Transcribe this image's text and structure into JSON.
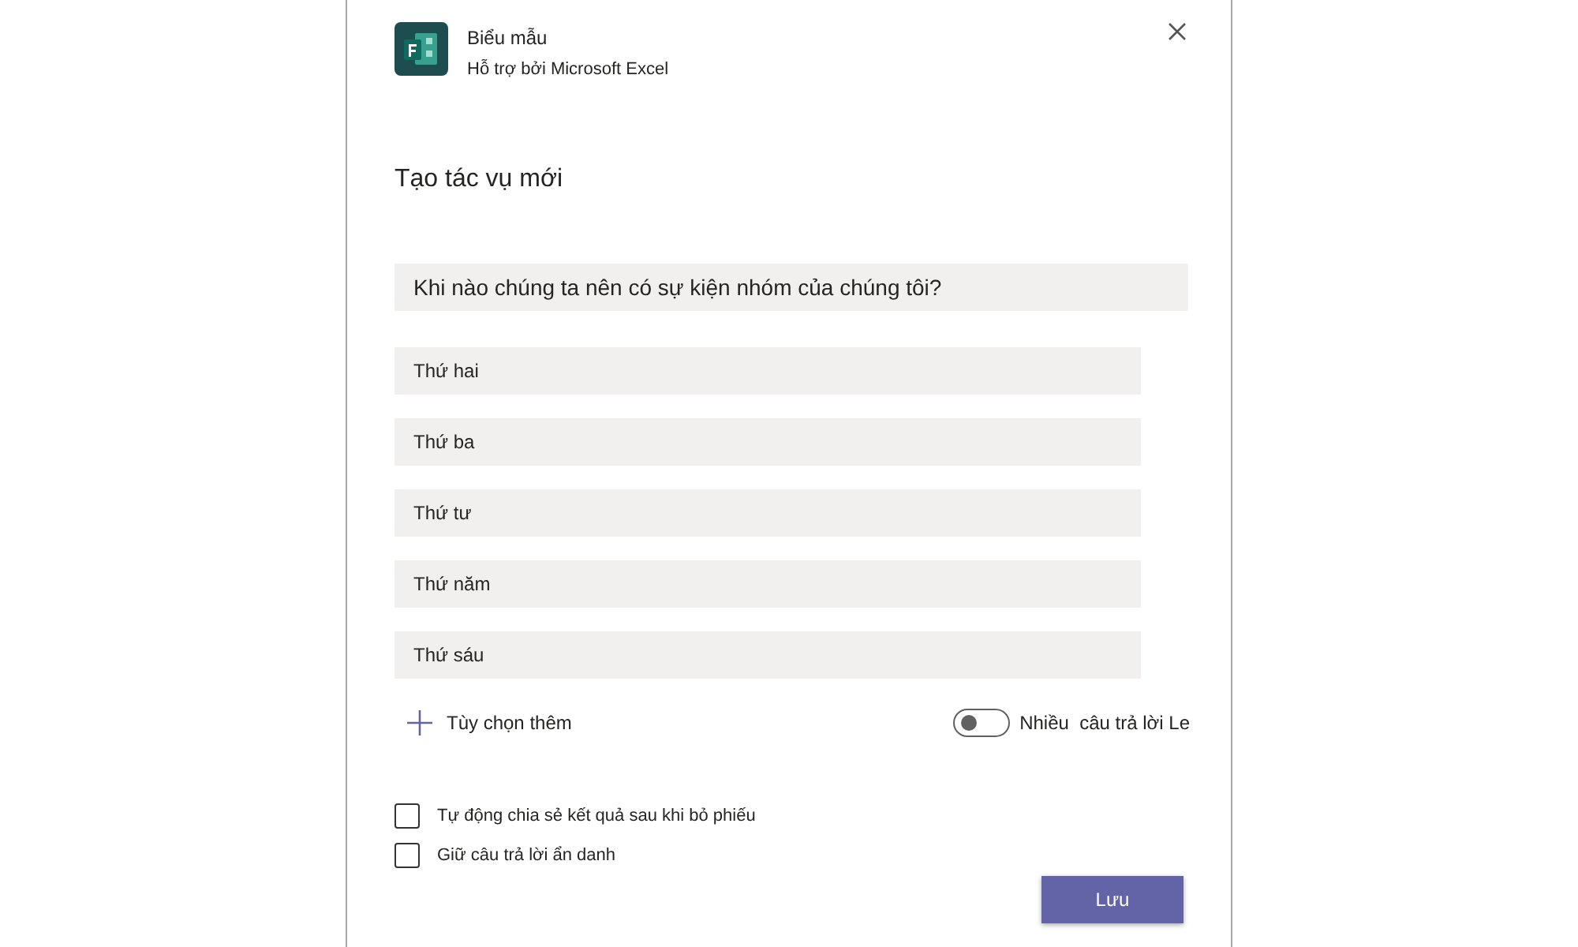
{
  "app": {
    "name": "Biểu mẫu",
    "subtitle": "Hỗ trợ bởi Microsoft Excel"
  },
  "heading": "Tạo tác vụ mới",
  "question": {
    "value": "Khi nào chúng ta nên có sự kiện nhóm của chúng tôi?"
  },
  "options": [
    {
      "value": "Thứ hai"
    },
    {
      "value": "Thứ ba"
    },
    {
      "value": "Thứ tư"
    },
    {
      "value": "Thứ năm"
    },
    {
      "value": "Thứ sáu"
    }
  ],
  "add_option": "Tùy chọn thêm",
  "multiple_answers": {
    "label": "Nhiều  câu trả lời Le",
    "on": false
  },
  "checkboxes": [
    {
      "label": "Tự động chia sẻ kết quả sau khi bỏ phiếu",
      "checked": false
    },
    {
      "label": "Giữ câu trả lời ẩn danh",
      "checked": false
    }
  ],
  "save_button": "Lưu"
}
